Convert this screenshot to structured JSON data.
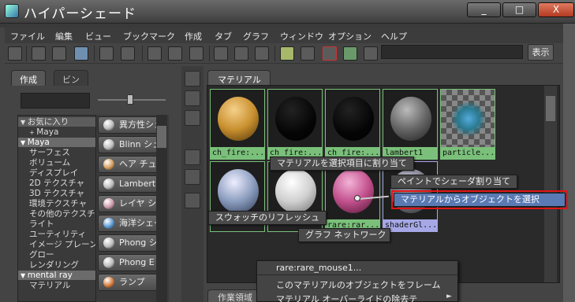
{
  "window": {
    "title": "ハイパーシェード",
    "buttons": [
      "_",
      "□",
      "X"
    ]
  },
  "menu": [
    "ファイル",
    "編集",
    "ビュー",
    "ブックマーク",
    "作成",
    "タブ",
    "グラフ",
    "ウィンドウ",
    "オプション",
    "ヘルプ"
  ],
  "toolbar": {
    "show_label": "表示",
    "search_value": ""
  },
  "left_panel": {
    "tabs": [
      "作成",
      "ビン"
    ],
    "tree": [
      {
        "label": "お気に入り",
        "indent": 0,
        "expander": "▼"
      },
      {
        "label": "Maya",
        "indent": 1,
        "expander": "+"
      },
      {
        "label": "Maya",
        "indent": 0,
        "expander": "▼",
        "category": true
      },
      {
        "label": "サーフェス",
        "indent": 1
      },
      {
        "label": "ボリューム",
        "indent": 1
      },
      {
        "label": "ディスプレイ",
        "indent": 1
      },
      {
        "label": "2D テクスチャ",
        "indent": 1
      },
      {
        "label": "3D テクスチャ",
        "indent": 1
      },
      {
        "label": "環境テクスチャ",
        "indent": 1
      },
      {
        "label": "その他のテクスチャ",
        "indent": 1
      },
      {
        "label": "ライト",
        "indent": 1
      },
      {
        "label": "ユーティリティ",
        "indent": 1
      },
      {
        "label": "イメージ プレーン",
        "indent": 1
      },
      {
        "label": "グロー",
        "indent": 1
      },
      {
        "label": "レンダリング",
        "indent": 1
      },
      {
        "label": "mental ray",
        "indent": 0,
        "expander": "▼",
        "category": true
      },
      {
        "label": "マテリアル",
        "indent": 1
      }
    ],
    "nodes": [
      "異方性シェーダ",
      "Blinn シェーダ",
      "ヘア チューブ",
      "Lambert",
      "レイヤ シェーダ",
      "海洋シェーダ",
      "Phong シェーダ",
      "Phong E",
      "ランプ"
    ]
  },
  "material_tab": "マテリアル",
  "swatches": [
    {
      "label": "ch_fire:...",
      "kind": "orange"
    },
    {
      "label": "ch_fire:...",
      "kind": "black"
    },
    {
      "label": "ch_fire:...",
      "kind": "black"
    },
    {
      "label": "lambert1",
      "kind": "grey"
    },
    {
      "label": "particle...",
      "kind": "particle"
    },
    {
      "label": "",
      "kind": "marble"
    },
    {
      "label": "",
      "kind": "white"
    },
    {
      "label": "rare:rar...",
      "kind": "pink"
    },
    {
      "label": "shaderGl...",
      "kind": "blue"
    }
  ],
  "marking_menu": {
    "assign": "マテリアルを選択項目に割り当て",
    "paint": "ペイントでシェーダ割り当て",
    "select_objects": "マテリアルからオブジェクトを選択",
    "refresh": "スウォッチのリフレッシュ",
    "graph": "グラフ ネットワーク"
  },
  "context_menu": {
    "header": "rare:rare_mouse1...",
    "items": [
      "このマテリアルのオブジェクトをフレーム",
      "マテリアル オーバーライドの除去テ"
    ]
  },
  "bottom_tab": "作業領域"
}
